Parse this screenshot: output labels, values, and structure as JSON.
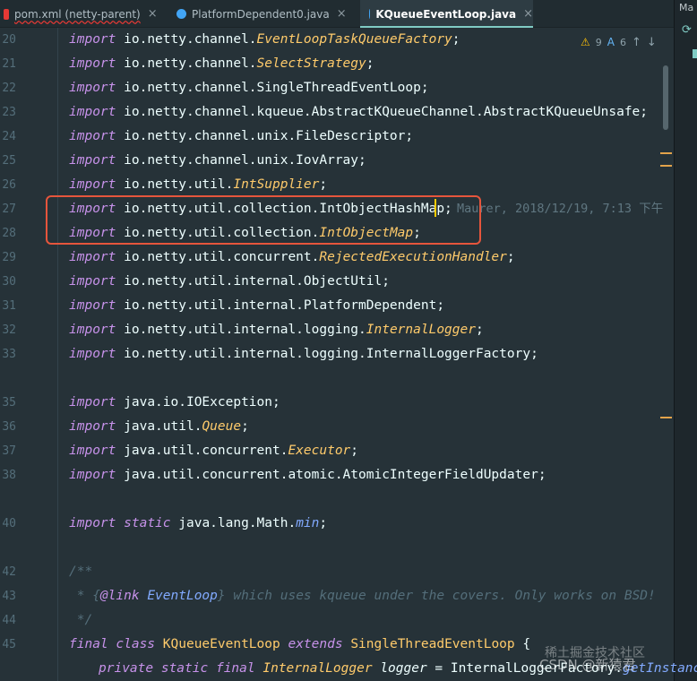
{
  "tabs": [
    {
      "label": "pom.xml (netty-parent)",
      "active": false,
      "icon": "maven-file-icon",
      "icon_color": "#e53935"
    },
    {
      "label": "PlatformDependent0.java",
      "active": false,
      "icon": "java-class-icon",
      "icon_color": "#42a5f5"
    },
    {
      "label": "KQueueEventLoop.java",
      "active": true,
      "icon": "java-class-icon",
      "icon_color": "#42a5f5"
    }
  ],
  "right_panel": {
    "label": "Ma"
  },
  "inspections": {
    "warnings": "9",
    "typos": "6"
  },
  "line_numbers": [
    "20",
    "21",
    "22",
    "23",
    "24",
    "25",
    "26",
    "27",
    "28",
    "29",
    "30",
    "31",
    "32",
    "33",
    "",
    "35",
    "36",
    "37",
    "38",
    "",
    "40",
    "",
    "42",
    "43",
    "44",
    "45",
    ""
  ],
  "code": {
    "l20": {
      "kw": "import",
      "pkg": "io.netty.channel.",
      "cls": "EventLoopTaskQueueFactory",
      "end": ";"
    },
    "l21": {
      "kw": "import",
      "pkg": "io.netty.channel.",
      "cls": "SelectStrategy",
      "end": ";"
    },
    "l22": {
      "kw": "import",
      "pkg": "io.netty.channel.SingleThreadEventLoop",
      "end": ";"
    },
    "l23": {
      "kw": "import",
      "pkg": "io.netty.channel.kqueue.AbstractKQueueChannel.AbstractKQueueUnsafe",
      "end": ";"
    },
    "l24": {
      "kw": "import",
      "pkg": "io.netty.channel.unix.FileDescriptor",
      "end": ";"
    },
    "l25": {
      "kw": "import",
      "pkg": "io.netty.channel.unix.IovArray",
      "end": ";"
    },
    "l26": {
      "kw": "import",
      "pkg": "io.netty.util.",
      "cls": "IntSupplier",
      "end": ";"
    },
    "l27": {
      "kw": "import",
      "pkg": "io.netty.util.collection.IntObjectHashMap",
      "end": ";"
    },
    "l28": {
      "kw": "import",
      "pkg": "io.netty.util.collection.",
      "cls": "IntObjectMap",
      "end": ";"
    },
    "l29": {
      "kw": "import",
      "pkg": "io.netty.util.concurrent.",
      "cls": "RejectedExecutionHandler",
      "end": ";"
    },
    "l30": {
      "kw": "import",
      "pkg": "io.netty.util.internal.ObjectUtil",
      "end": ";"
    },
    "l31": {
      "kw": "import",
      "pkg": "io.netty.util.internal.PlatformDependent",
      "end": ";"
    },
    "l32": {
      "kw": "import",
      "pkg": "io.netty.util.internal.logging.",
      "cls": "InternalLogger",
      "end": ";"
    },
    "l33": {
      "kw": "import",
      "pkg": "io.netty.util.internal.logging.InternalLoggerFactory",
      "end": ";"
    },
    "l35": {
      "kw": "import",
      "pkg": "java.io.IOException",
      "end": ";"
    },
    "l36": {
      "kw": "import",
      "pkg": "java.util.",
      "cls": "Queue",
      "end": ";"
    },
    "l37": {
      "kw": "import",
      "pkg": "java.util.concurrent.",
      "cls": "Executor",
      "end": ";"
    },
    "l38": {
      "kw": "import",
      "pkg": "java.util.concurrent.atomic.AtomicIntegerFieldUpdater",
      "end": ";"
    },
    "l40": {
      "kw": "import",
      "kw2": "static",
      "pkg": "java.lang.Math.",
      "fn": "min",
      "end": ";"
    },
    "l42": {
      "text": "/**"
    },
    "l43": {
      "star": " * {",
      "tag": "@link",
      "ref": "EventLoop",
      "rest": "} which uses kqueue under the covers. Only works on BSD!"
    },
    "l44": {
      "text": " */"
    },
    "l45": {
      "kw1": "final",
      "kw2": "class",
      "name": "KQueueEventLoop",
      "kw3": "extends",
      "parent": "SingleThreadEventLoop",
      "end": " {"
    },
    "l46": {
      "kw1": "private",
      "kw2": "static",
      "kw3": "final",
      "type": "InternalLogger",
      "var": "logger",
      "eq": " = ",
      "call": "InternalLoggerFactory.",
      "method": "getInstance"
    }
  },
  "blame": "Maurer, 2018/12/19, 7:13 下午",
  "watermark": "稀土掘金技术社区",
  "credit": "CSDN @新猿君"
}
